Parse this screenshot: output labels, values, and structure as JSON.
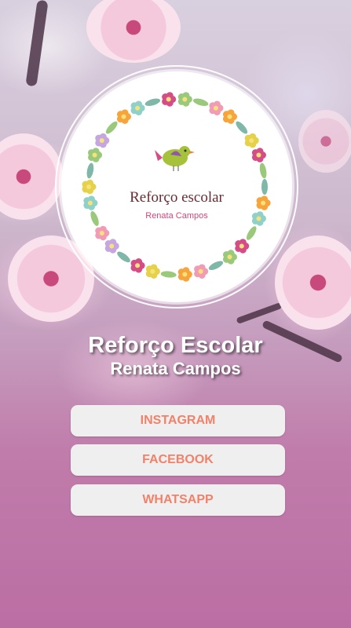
{
  "logo": {
    "title": "Reforço escolar",
    "subtitle": "Renata Campos"
  },
  "header": {
    "title": "Reforço Escolar",
    "subtitle": "Renata Campos"
  },
  "links": [
    {
      "label": "INSTAGRAM"
    },
    {
      "label": "FACEBOOK"
    },
    {
      "label": "WHATSAPP"
    }
  ],
  "colors": {
    "button_text": "#f0826a",
    "button_bg": "#efeff0",
    "background_bottom": "#bb6ea3"
  }
}
